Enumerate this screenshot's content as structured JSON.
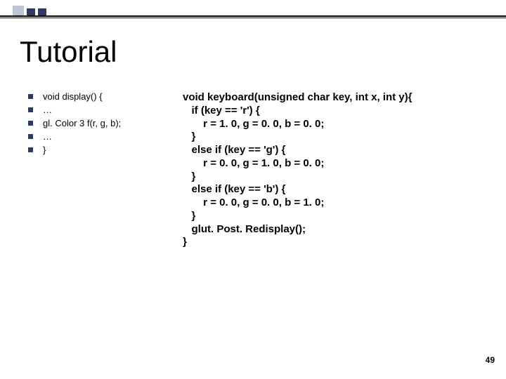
{
  "header": {
    "title": "Tutorial"
  },
  "left_bullets": [
    "void display() {",
    "…",
    "gl. Color 3 f(r, g, b);",
    "…",
    "}"
  ],
  "right_code": [
    "void keyboard(unsigned char key, int x, int y){",
    "   if (key == 'r') {",
    "       r = 1. 0, g = 0. 0, b = 0. 0;",
    "   }",
    "   else if (key == 'g') {",
    "       r = 0. 0, g = 1. 0, b = 0. 0;",
    "   }",
    "   else if (key == 'b') {",
    "       r = 0. 0, g = 0. 0, b = 1. 0;",
    "   }",
    "   glut. Post. Redisplay();",
    "}"
  ],
  "page_number": "49"
}
